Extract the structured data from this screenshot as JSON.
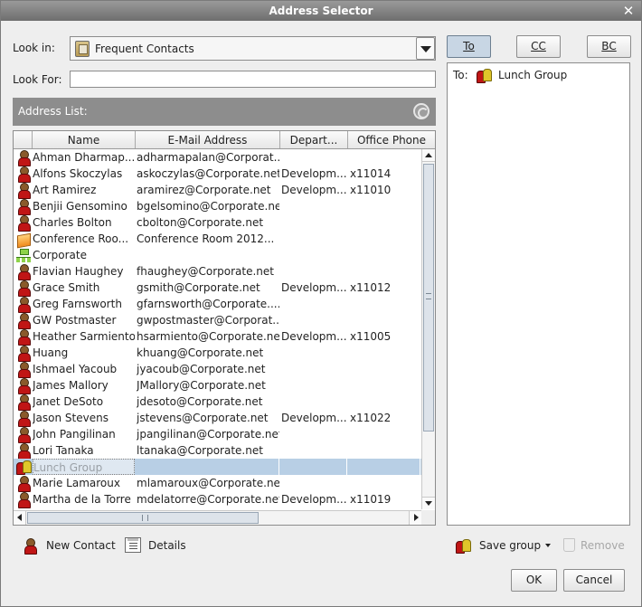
{
  "window": {
    "title": "Address Selector"
  },
  "look_in": {
    "label": "Look in:",
    "value": "Frequent Contacts"
  },
  "look_for": {
    "label": "Look For:",
    "value": ""
  },
  "address_list": {
    "label": "Address List:"
  },
  "columns": [
    "Name",
    "E-Mail Address",
    "Depart...",
    "Office Phone"
  ],
  "rows": [
    {
      "icon": "person",
      "name": "Ahman Dharmap...",
      "email": "adharmapalan@Corporat...",
      "dept": "",
      "phone": ""
    },
    {
      "icon": "person",
      "name": "Alfons Skoczylas",
      "email": "askoczylas@Corporate.net",
      "dept": "Developm...",
      "phone": "x11014"
    },
    {
      "icon": "person",
      "name": "Art Ramirez",
      "email": "aramirez@Corporate.net",
      "dept": "Developm...",
      "phone": "x11010"
    },
    {
      "icon": "person",
      "name": "Benjii Gensomino",
      "email": "bgelsomino@Corporate.net",
      "dept": "",
      "phone": ""
    },
    {
      "icon": "person",
      "name": "Charles Bolton",
      "email": "cbolton@Corporate.net",
      "dept": "",
      "phone": ""
    },
    {
      "icon": "resource",
      "name": "Conference Roo...",
      "email": "Conference Room 2012...",
      "dept": "",
      "phone": ""
    },
    {
      "icon": "org",
      "name": "Corporate",
      "email": "",
      "dept": "",
      "phone": ""
    },
    {
      "icon": "person",
      "name": "Flavian Haughey",
      "email": "fhaughey@Corporate.net",
      "dept": "",
      "phone": ""
    },
    {
      "icon": "person",
      "name": "Grace Smith",
      "email": "gsmith@Corporate.net",
      "dept": "Developm...",
      "phone": "x11012"
    },
    {
      "icon": "person",
      "name": "Greg Farnsworth",
      "email": "gfarnsworth@Corporate....",
      "dept": "",
      "phone": ""
    },
    {
      "icon": "person",
      "name": "GW Postmaster",
      "email": "gwpostmaster@Corporat...",
      "dept": "",
      "phone": ""
    },
    {
      "icon": "person",
      "name": "Heather Sarmiento",
      "email": "hsarmiento@Corporate.net",
      "dept": "Developm...",
      "phone": "x11005"
    },
    {
      "icon": "person",
      "name": "Huang",
      "email": "khuang@Corporate.net",
      "dept": "",
      "phone": ""
    },
    {
      "icon": "person",
      "name": "Ishmael Yacoub",
      "email": "jyacoub@Corporate.net",
      "dept": "",
      "phone": ""
    },
    {
      "icon": "person",
      "name": "James Mallory",
      "email": "JMallory@Corporate.net",
      "dept": "",
      "phone": ""
    },
    {
      "icon": "person",
      "name": "Janet DeSoto",
      "email": "jdesoto@Corporate.net",
      "dept": "",
      "phone": ""
    },
    {
      "icon": "person",
      "name": "Jason Stevens",
      "email": "jstevens@Corporate.net",
      "dept": "Developm...",
      "phone": "x11022"
    },
    {
      "icon": "person",
      "name": "John Pangilinan",
      "email": "jpangilinan@Corporate.net",
      "dept": "",
      "phone": ""
    },
    {
      "icon": "person",
      "name": "Lori Tanaka",
      "email": "ltanaka@Corporate.net",
      "dept": "",
      "phone": ""
    },
    {
      "icon": "group",
      "name": "Lunch Group",
      "email": "",
      "dept": "",
      "phone": "",
      "selected": true
    },
    {
      "icon": "person",
      "name": "Marie Lamaroux",
      "email": "mlamaroux@Corporate.net",
      "dept": "",
      "phone": ""
    },
    {
      "icon": "person",
      "name": "Martha de la Torre",
      "email": "mdelatorre@Corporate.net",
      "dept": "Developm...",
      "phone": "x11019"
    }
  ],
  "recipient_buttons": {
    "to": "To",
    "cc": "CC",
    "bc": "BC"
  },
  "recipients": {
    "to_label": "To:",
    "to_value": "Lunch Group"
  },
  "bottom": {
    "new_contact": "New Contact",
    "details": "Details",
    "save_group": "Save group",
    "remove": "Remove",
    "ok": "OK",
    "cancel": "Cancel"
  },
  "colors": {
    "selection": "#b8cfe5",
    "title_bar": "#7f7f7f",
    "list_header": "#8d8d8d"
  }
}
